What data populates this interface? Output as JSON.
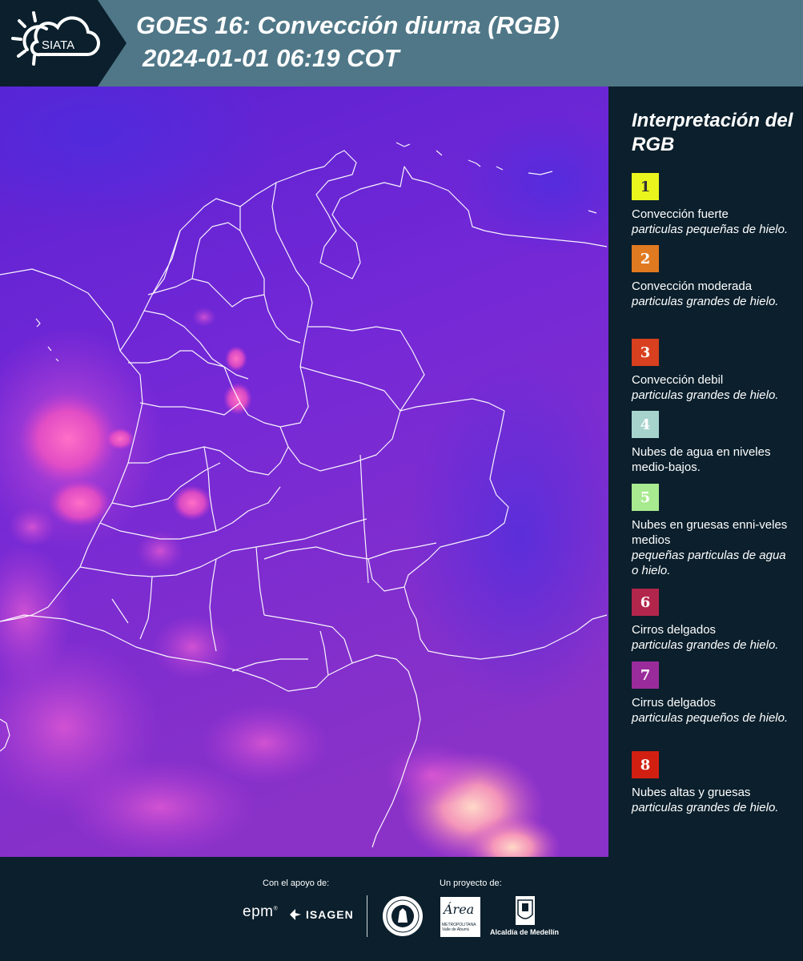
{
  "header": {
    "logo_text": "SIATA",
    "title_line1": "GOES 16: Convección diurna (RGB)",
    "title_line2": "2024-01-01 06:19 COT"
  },
  "map": {
    "image_description_icon": "satellite-composite-map",
    "background_color": "#6a2ad8"
  },
  "legend": {
    "title": "Interpretación del RGB",
    "items": [
      {
        "number": "1",
        "color": "#e9f51d",
        "text_color": "#333333",
        "main": "Convección fuerte",
        "sub": "particulas pequeñas de hielo."
      },
      {
        "number": "2",
        "color": "#e07a20",
        "text_color": "#ffffff",
        "main": "Convección moderada",
        "sub": "particulas grandes de hielo."
      },
      {
        "number": "3",
        "color": "#d9401f",
        "text_color": "#ffffff",
        "main": "Convección debil",
        "sub": "particulas grandes de hielo."
      },
      {
        "number": "4",
        "color": "#a6d4cd",
        "text_color": "#ffffff",
        "main": "Nubes de agua en niveles medio-bajos.",
        "sub": ""
      },
      {
        "number": "5",
        "color": "#a8ea8f",
        "text_color": "#ffffff",
        "main": "Nubes en gruesas enni-veles medios",
        "sub": "pequeñas particulas de agua o hielo."
      },
      {
        "number": "6",
        "color": "#b3264c",
        "text_color": "#ffffff",
        "main": "Cirros delgados",
        "sub": "particulas grandes de hielo."
      },
      {
        "number": "7",
        "color": "#9a2b9a",
        "text_color": "#ffffff",
        "main": "Cirrus delgados",
        "sub": "particulas pequeños de hielo."
      },
      {
        "number": "8",
        "color": "#d11f12",
        "text_color": "#ffffff",
        "main": "Nubes altas y gruesas",
        "sub": "particulas grandes de hielo."
      }
    ]
  },
  "footer": {
    "support_label": "Con el apoyo de:",
    "project_label": "Un proyecto de:",
    "epm": "epm",
    "isagen": "ISAGEN",
    "area_text": "Área",
    "area_sub": "METROPOLITANA Valle de Aburrá",
    "medellin": "Alcaldía de Medellín"
  }
}
